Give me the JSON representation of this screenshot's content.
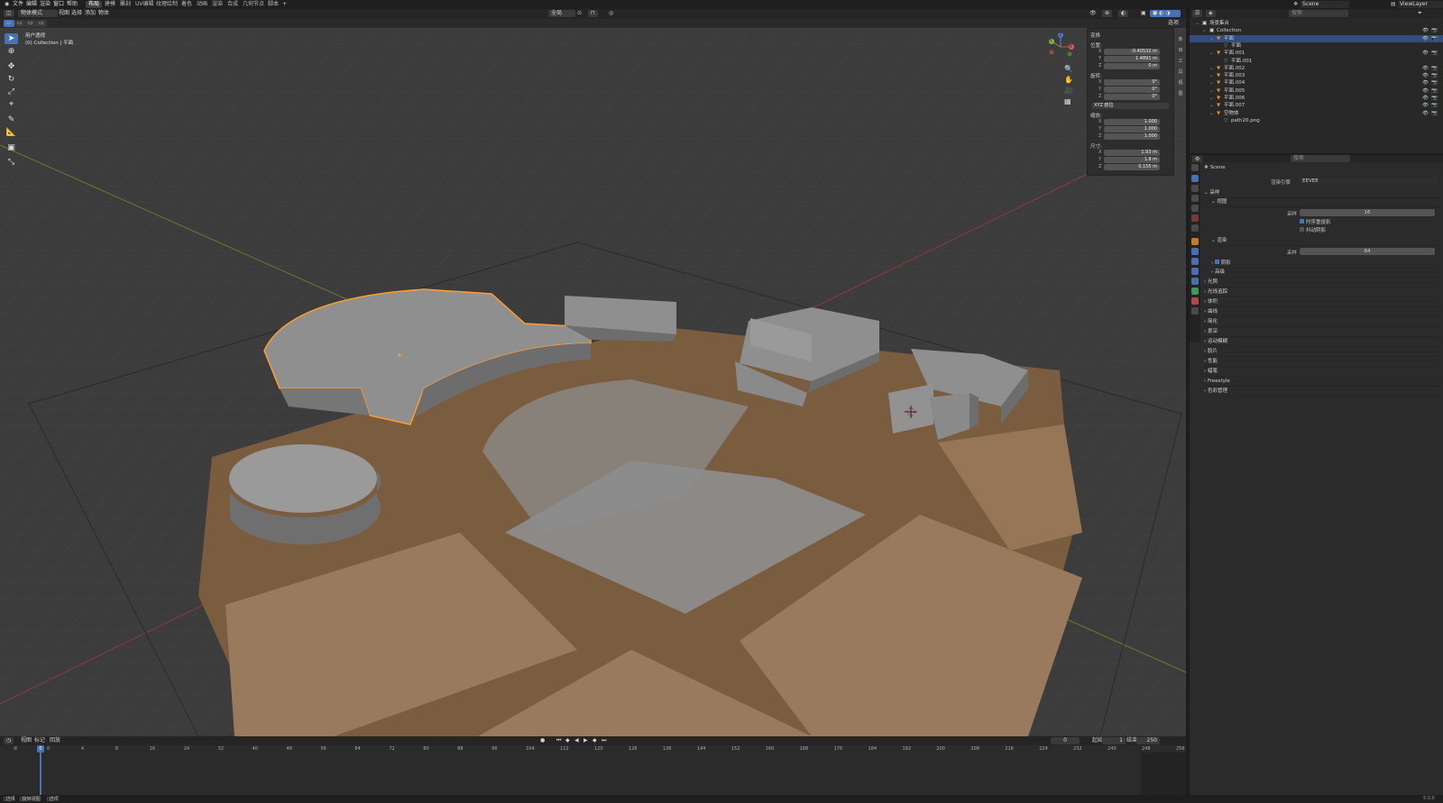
{
  "top_menu": [
    "文件",
    "编辑",
    "渲染",
    "窗口",
    "帮助"
  ],
  "workspaces": [
    {
      "label": "布局",
      "active": true
    },
    {
      "label": "建模"
    },
    {
      "label": "雕刻"
    },
    {
      "label": "UV编辑"
    },
    {
      "label": "纹理绘制"
    },
    {
      "label": "着色"
    },
    {
      "label": "动画"
    },
    {
      "label": "渲染"
    },
    {
      "label": "合成"
    },
    {
      "label": "几何节点"
    },
    {
      "label": "脚本"
    }
  ],
  "add_tab_icon": "plus-icon",
  "scene": {
    "label": "Scene"
  },
  "view_layer": {
    "label": "ViewLayer"
  },
  "viewport_header": {
    "mode": "物体模式",
    "menus": [
      "视图",
      "选择",
      "添加",
      "物体"
    ],
    "transform_orientation": "全局",
    "options_label": "选项"
  },
  "viewport_overlay": {
    "view_name": "用户透视",
    "collection_info": "(0) Collection | 平面"
  },
  "npanel": {
    "section": "变换",
    "location_label": "位置:",
    "location": {
      "x": "-0.40532 m",
      "y": "1.4891 m",
      "z": "0 m"
    },
    "rotation_label": "旋转:",
    "rotation": {
      "x": "0°",
      "y": "0°",
      "z": "0°"
    },
    "rotation_mode": "XYZ 欧拉",
    "scale_label": "缩放:",
    "scale": {
      "x": "1.000",
      "y": "1.000",
      "z": "1.000"
    },
    "dimensions_label": "尺寸:",
    "dimensions": {
      "x": "1.93 m",
      "y": "1.8 m",
      "z": "0.155 m"
    },
    "tabs": [
      "条目",
      "工具",
      "视图"
    ]
  },
  "axis_labels": {
    "x": "X",
    "y": "Y",
    "z": "Z"
  },
  "outliner": {
    "search_placeholder": "搜索",
    "rows": [
      {
        "label": "场景集合",
        "indent": 0,
        "selected": false
      },
      {
        "label": "Collection",
        "indent": 1,
        "selected": false
      },
      {
        "label": "平面",
        "indent": 2,
        "selected": true
      },
      {
        "label": "平面",
        "indent": 3,
        "selected": false
      },
      {
        "label": "平面.001",
        "indent": 2,
        "selected": false
      },
      {
        "label": "平面.001",
        "indent": 3,
        "selected": false
      },
      {
        "label": "平面.002",
        "indent": 2,
        "selected": false
      },
      {
        "label": "平面.003",
        "indent": 2,
        "selected": false
      },
      {
        "label": "平面.004",
        "indent": 2,
        "selected": false
      },
      {
        "label": "平面.005",
        "indent": 2,
        "selected": false
      },
      {
        "label": "平面.006",
        "indent": 2,
        "selected": false
      },
      {
        "label": "平面.007",
        "indent": 2,
        "selected": false
      },
      {
        "label": "空物体",
        "indent": 2,
        "selected": false
      },
      {
        "label": "path20.png",
        "indent": 3,
        "selected": false
      }
    ]
  },
  "properties": {
    "search_placeholder": "搜索",
    "scene_label": "Scene",
    "render_engine_label": "渲染引擎",
    "render_engine": "EEVEE",
    "sampling": "采样",
    "viewport": "视图",
    "viewport_samples_label": "采样",
    "viewport_samples": "16",
    "temporal_reprojection": "时序重投影",
    "jitter_shadows": "抖动阴影",
    "render": "渲染",
    "render_samples_label": "采样",
    "render_samples": "64",
    "shadows": "阴影",
    "advanced": "高级",
    "sections": [
      "光照",
      "光线追踪",
      "体积",
      "曲线",
      "简化",
      "景深",
      "运动模糊",
      "胶片",
      "性能",
      "蜡笔",
      "Freestyle",
      "色彩管理"
    ]
  },
  "timeline": {
    "menus": [
      "视图",
      "标记",
      "回放"
    ],
    "current_frame": "0",
    "start_label": "起始",
    "start": "1",
    "end_label": "结束",
    "end": "250",
    "ticks": [
      "-8",
      "0",
      "4",
      "8",
      "16",
      "24",
      "32",
      "40",
      "48",
      "56",
      "64",
      "72",
      "80",
      "88",
      "96",
      "104",
      "112",
      "120",
      "128",
      "136",
      "144",
      "152",
      "160",
      "168",
      "176",
      "184",
      "192",
      "200",
      "208",
      "216",
      "224",
      "232",
      "240",
      "248",
      "256"
    ]
  },
  "statusbar": {
    "items": [
      "选择",
      "旋转视图",
      "选项"
    ],
    "version": "5.0.0"
  },
  "colors": {
    "accent": "#4772b3",
    "selection": "#ff9d2e",
    "floor": "#8a6848",
    "building": "#8d8d8d"
  }
}
